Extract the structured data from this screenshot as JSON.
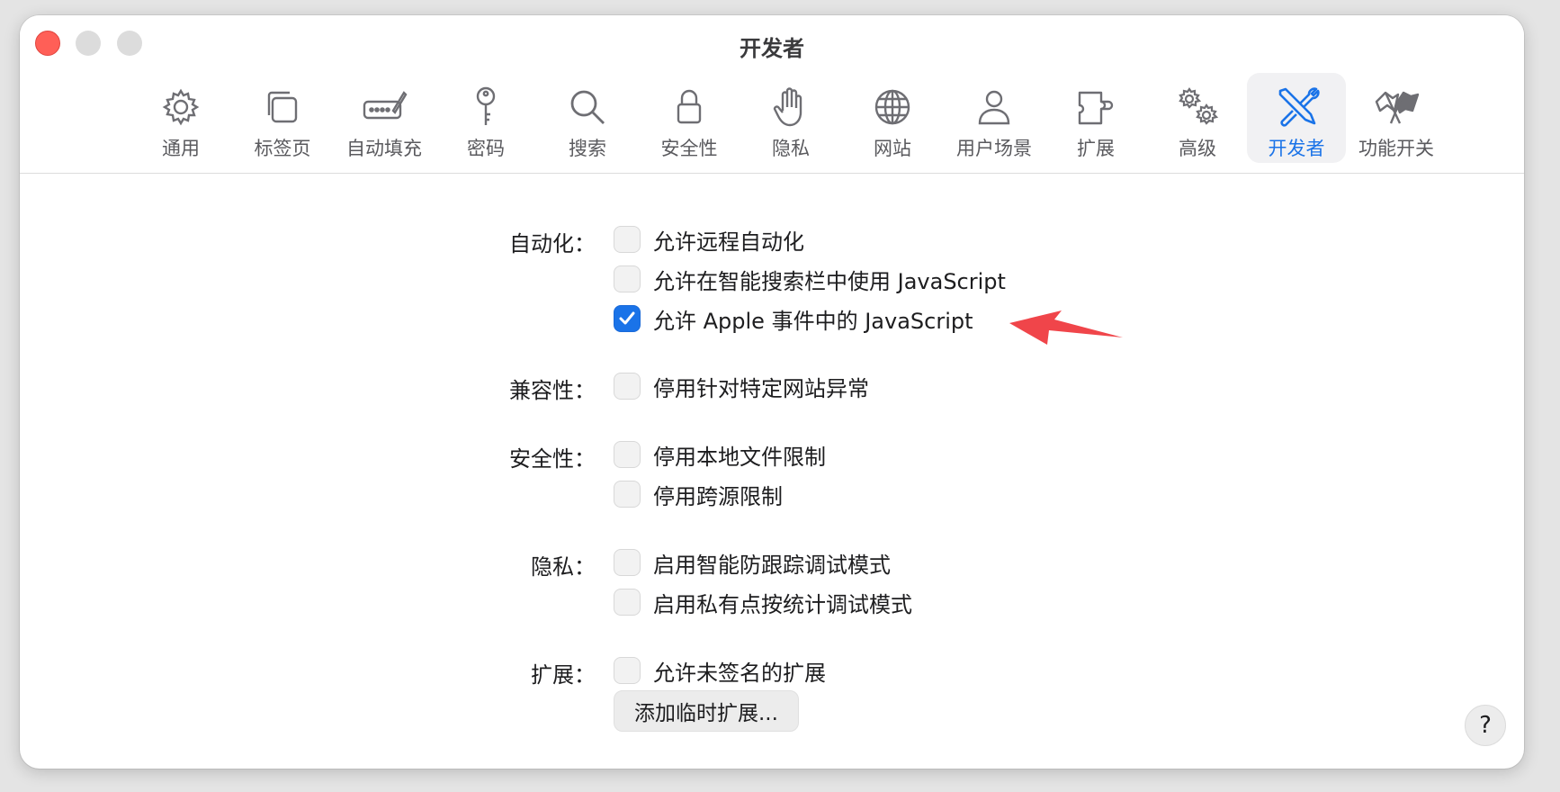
{
  "window": {
    "title": "开发者"
  },
  "toolbar": {
    "items": [
      {
        "label": "通用",
        "icon": "gear-icon"
      },
      {
        "label": "标签页",
        "icon": "tabs-icon"
      },
      {
        "label": "自动填充",
        "icon": "autofill-icon"
      },
      {
        "label": "密码",
        "icon": "key-icon"
      },
      {
        "label": "搜索",
        "icon": "search-icon"
      },
      {
        "label": "安全性",
        "icon": "lock-icon"
      },
      {
        "label": "隐私",
        "icon": "hand-icon"
      },
      {
        "label": "网站",
        "icon": "globe-icon"
      },
      {
        "label": "用户场景",
        "icon": "person-icon"
      },
      {
        "label": "扩展",
        "icon": "puzzle-icon"
      },
      {
        "label": "高级",
        "icon": "gears-icon"
      },
      {
        "label": "开发者",
        "icon": "developer-tools-icon"
      },
      {
        "label": "功能开关",
        "icon": "flags-icon"
      }
    ],
    "selected": "开发者"
  },
  "sections": {
    "automation": {
      "label": "自动化：",
      "options": [
        {
          "label": "允许远程自动化",
          "checked": false
        },
        {
          "label": "允许在智能搜索栏中使用 JavaScript",
          "checked": false
        },
        {
          "label": "允许 Apple 事件中的 JavaScript",
          "checked": true
        }
      ]
    },
    "compatibility": {
      "label": "兼容性：",
      "options": [
        {
          "label": "停用针对特定网站异常",
          "checked": false
        }
      ]
    },
    "security": {
      "label": "安全性：",
      "options": [
        {
          "label": "停用本地文件限制",
          "checked": false
        },
        {
          "label": "停用跨源限制",
          "checked": false
        }
      ]
    },
    "privacy": {
      "label": "隐私：",
      "options": [
        {
          "label": "启用智能防跟踪调试模式",
          "checked": false
        },
        {
          "label": "启用私有点按统计调试模式",
          "checked": false
        }
      ]
    },
    "extensions": {
      "label": "扩展：",
      "options": [
        {
          "label": "允许未签名的扩展",
          "checked": false
        }
      ],
      "button_label": "添加临时扩展..."
    }
  },
  "help": {
    "label": "?"
  },
  "colors": {
    "accent": "#1a73e8",
    "annotation_arrow": "#f0454a",
    "close": "#ff5f57"
  }
}
